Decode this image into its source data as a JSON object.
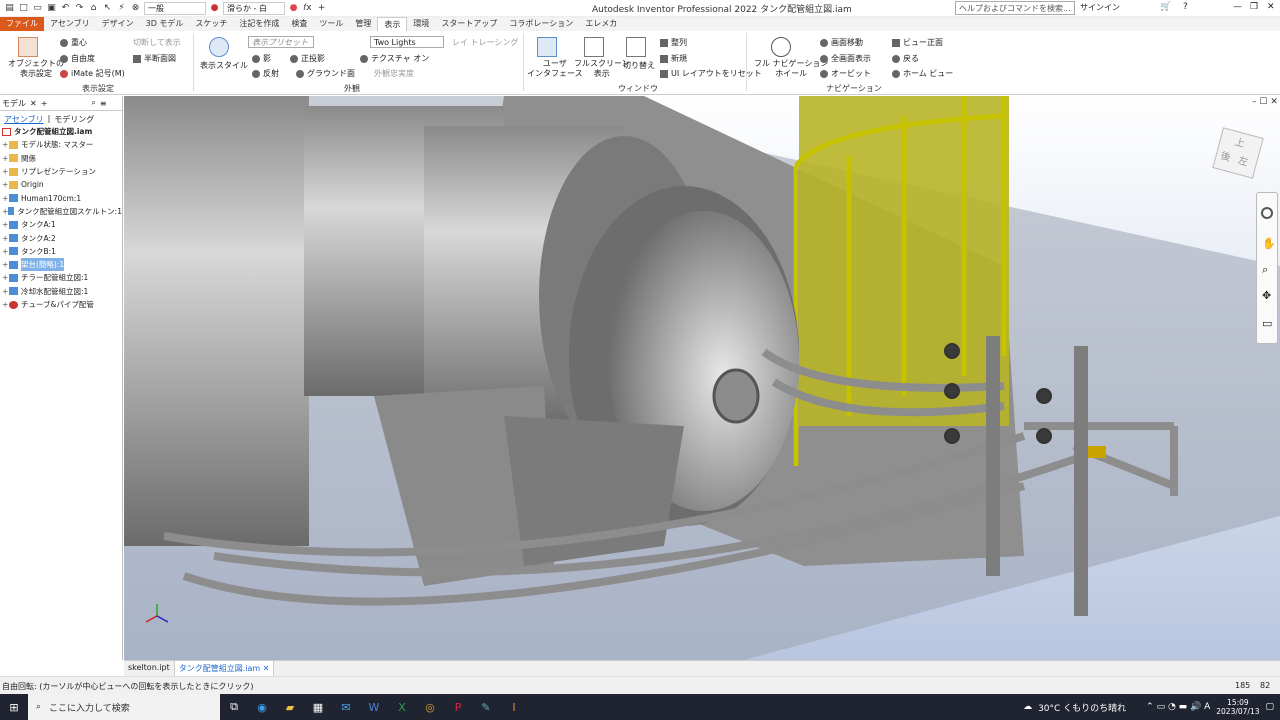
{
  "app_title": "Autodesk Inventor Professional 2022   タンク配管組立図.iam",
  "quick_access": {
    "material": "一般",
    "appearance": "滑らか - 白"
  },
  "search": {
    "placeholder": "ヘルプおよびコマンドを検索..."
  },
  "signin": "サインイン",
  "tabs": [
    "ファイル",
    "アセンブリ",
    "デザイン",
    "3D モデル",
    "スケッチ",
    "注記を作成",
    "検査",
    "ツール",
    "管理",
    "表示",
    "環境",
    "スタートアップ",
    "コラボレーション",
    "エレメカ"
  ],
  "ribbon": {
    "obj_display": "オブジェクトの\n表示設定",
    "center": "重心",
    "dof": "自由度",
    "imate": "iMate 記号(M)",
    "slice": "切断して表示",
    "half": "半断面図",
    "group1": "表示設定",
    "visual_style": "表示スタイル",
    "view_preset": "表示プリセット",
    "lights": "Two Lights",
    "raytrace": "レイ トレーシング",
    "shadow": "影",
    "ortho": "正投影",
    "texture": "テクスチャ オン",
    "reflect": "反射",
    "ground": "グラウンド面",
    "appearance_fidelity": "外観忠実度",
    "group2": "外観",
    "user_if": "ユーザ\nインタフェース",
    "fullscreen": "フルスクリーン\n表示",
    "switch": "切り替え",
    "arrange": "整列",
    "new": "新規",
    "reset_ui": "UI レイアウトをリセット",
    "group3": "ウィンドウ",
    "full_nav": "フル ナビゲーション\nホイール",
    "pan": "画面移動",
    "zoom_all": "全画面表示",
    "orbit": "オービット",
    "view_face": "ビュー正面",
    "back": "戻る",
    "home": "ホーム ビュー",
    "group4": "ナビゲーション"
  },
  "browser": {
    "header": "モデル",
    "sub_assembly": "アセンブリ",
    "sub_modeling": "モデリング",
    "items": [
      {
        "label": "タンク配管組立図.iam",
        "root": true
      },
      {
        "label": "モデル状態: マスター"
      },
      {
        "label": "関係"
      },
      {
        "label": "リプレゼンテーション"
      },
      {
        "label": "Origin"
      },
      {
        "label": "Human170cm:1"
      },
      {
        "label": "タンク配管組立図スケルトン:1"
      },
      {
        "label": "タンクA:1"
      },
      {
        "label": "タンクA:2"
      },
      {
        "label": "タンクB:1"
      },
      {
        "label": "架台(簡略):1",
        "selected": true
      },
      {
        "label": "チラー配管組立図:1"
      },
      {
        "label": "冷却水配管組立図:1"
      },
      {
        "label": "チューブ&パイプ配管"
      }
    ]
  },
  "viewcube": {
    "top": "上",
    "back": "後",
    "left": "左"
  },
  "doc_tabs": [
    "skelton.ipt",
    "タンク配管組立図.iam"
  ],
  "status": {
    "text": "自由回転: (カーソルが中心ビューへの回転を表示したときにクリック)",
    "n1": "185",
    "n2": "82"
  },
  "taskbar": {
    "search": "ここに入力して検索",
    "weather": "30°C  くもりのち晴れ",
    "time": "15:09",
    "date": "2023/07/13"
  }
}
